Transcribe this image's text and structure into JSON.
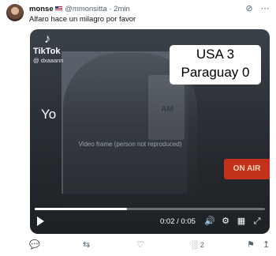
{
  "post": {
    "author_name": "monse",
    "handle": "@mmonsitta",
    "separator": "·",
    "time": "2min",
    "text": "Alfaro hace un milagro por favor"
  },
  "header_icons": [
    "grok-icon",
    "more-icon"
  ],
  "video": {
    "watermark_app": "TikTok",
    "watermark_user": "@ dxaaann",
    "score_line_1": "USA 3",
    "score_line_2": "Paraguay 0",
    "background_text": "Yo",
    "sign_text": "AM",
    "onair_text": "ON AIR",
    "current_time": "0:02",
    "duration": "0:05",
    "progress_fraction": 0.4,
    "placeholder_note": "Video frame (person not reproduced)"
  },
  "actions": {
    "views": "2"
  },
  "colors": {
    "text": "#0f1419",
    "muted": "#536471",
    "onair": "#c4311a"
  }
}
